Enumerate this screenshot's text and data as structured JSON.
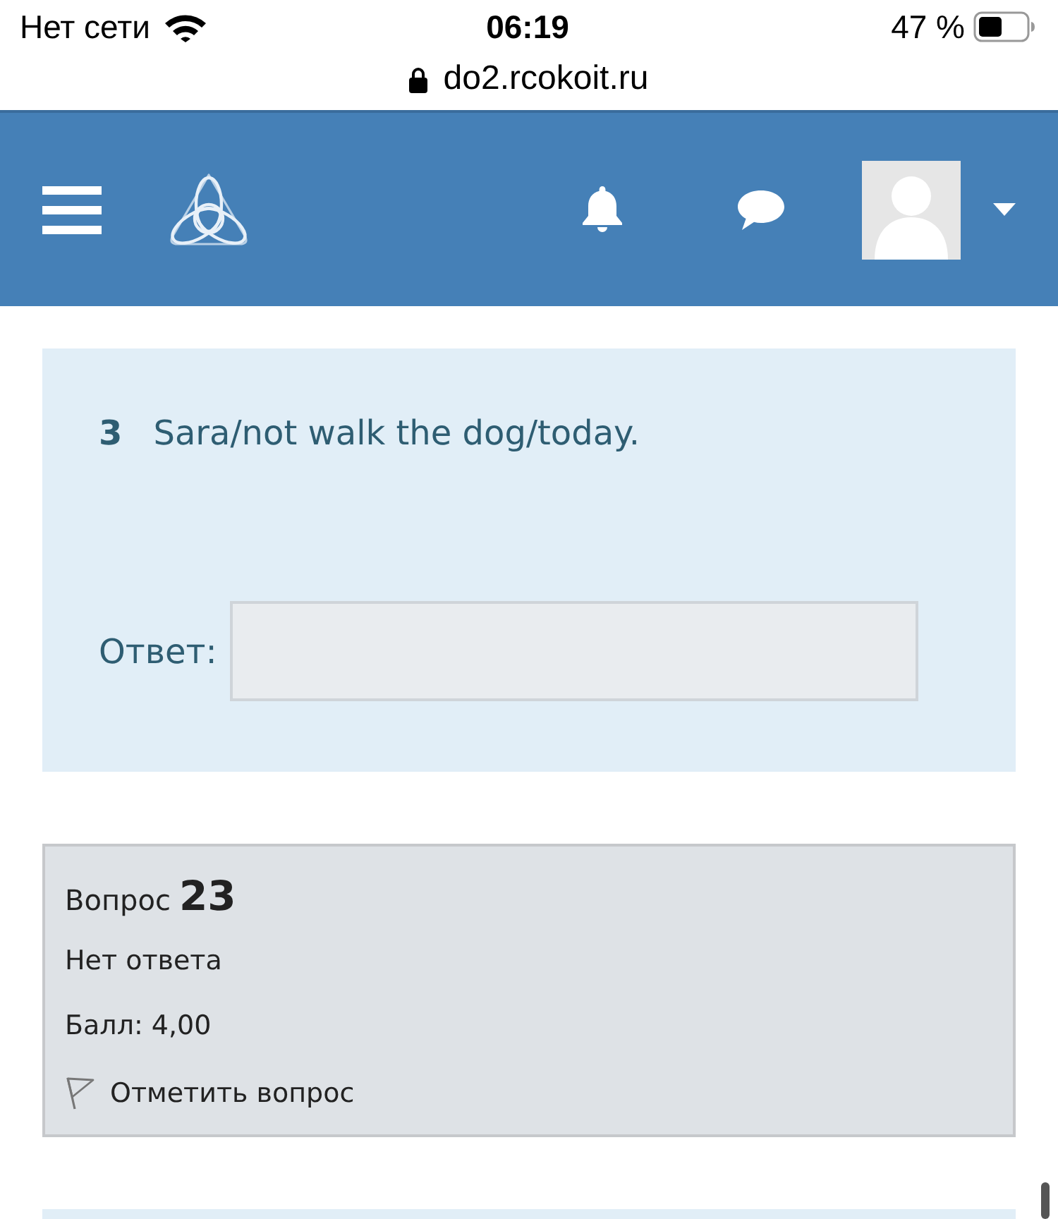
{
  "status_bar": {
    "network": "Нет сети",
    "time": "06:19",
    "battery": "47 %"
  },
  "address_bar": {
    "url": "do2.rcokoit.ru"
  },
  "question_text": {
    "number": "3",
    "text": "Sara/not walk the dog/today.",
    "answer_label": "Ответ:"
  },
  "question_info": {
    "label": "Вопрос",
    "number": "23",
    "status": "Нет ответа",
    "grade": "Балл: 4,00",
    "flag": {
      "label": "Отметить вопрос",
      "flagged": false
    }
  }
}
